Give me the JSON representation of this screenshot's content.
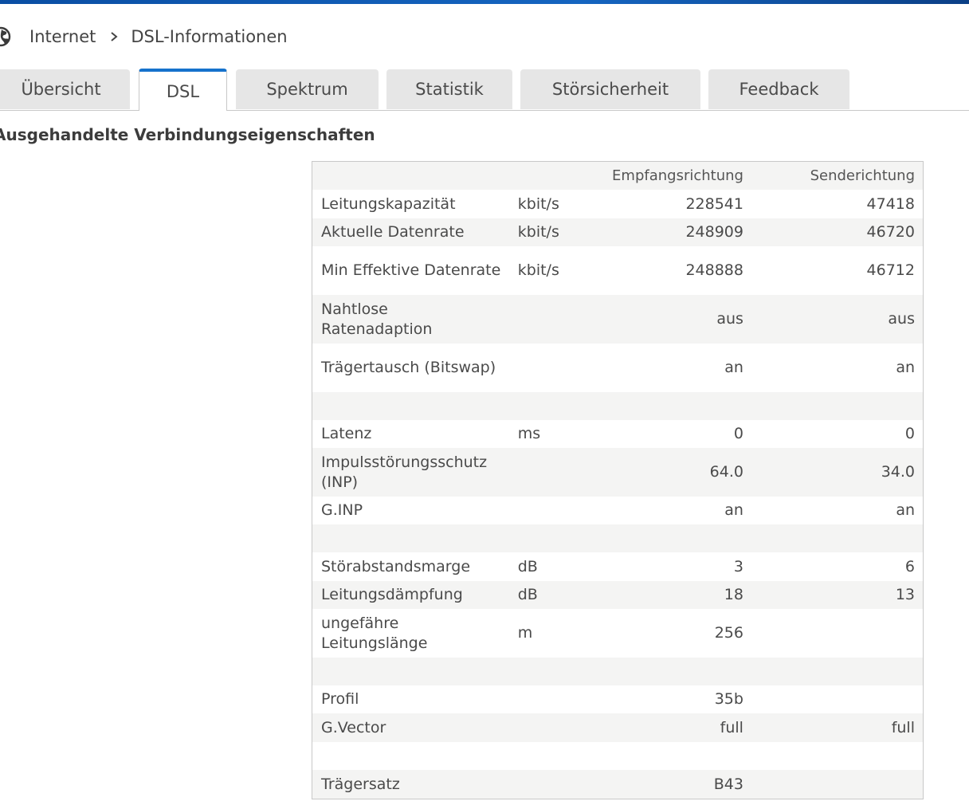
{
  "breadcrumb": {
    "icon": "globe-icon",
    "items": [
      "Internet",
      "DSL-Informationen"
    ]
  },
  "tabs": [
    {
      "label": "Übersicht",
      "active": false
    },
    {
      "label": "DSL",
      "active": true
    },
    {
      "label": "Spektrum",
      "active": false
    },
    {
      "label": "Statistik",
      "active": false
    },
    {
      "label": "Störsicherheit",
      "active": false
    },
    {
      "label": "Feedback",
      "active": false
    }
  ],
  "section": {
    "title": "Ausgehandelte Verbindungseigenschaften"
  },
  "table": {
    "headers": [
      "",
      "",
      "Empfangsrichtung",
      "Senderichtung"
    ],
    "rows": [
      {
        "label": "Leitungskapazität",
        "unit": "kbit/s",
        "rx": "228541",
        "tx": "47418"
      },
      {
        "label": "Aktuelle Datenrate",
        "unit": "kbit/s",
        "rx": "248909",
        "tx": "46720"
      },
      {
        "label": "Min Effektive Datenrate",
        "unit": "kbit/s",
        "rx": "248888",
        "tx": "46712"
      },
      {
        "label": "Nahtlose Ratenadaption",
        "unit": "",
        "rx": "aus",
        "tx": "aus"
      },
      {
        "label": "Trägertausch (Bitswap)",
        "unit": "",
        "rx": "an",
        "tx": "an"
      },
      {
        "label": "",
        "unit": "",
        "rx": "",
        "tx": ""
      },
      {
        "label": "Latenz",
        "unit": "ms",
        "rx": "0",
        "tx": "0"
      },
      {
        "label": "Impulsstörungsschutz (INP)",
        "unit": "",
        "rx": "64.0",
        "tx": "34.0"
      },
      {
        "label": "G.INP",
        "unit": "",
        "rx": "an",
        "tx": "an"
      },
      {
        "label": "",
        "unit": "",
        "rx": "",
        "tx": ""
      },
      {
        "label": "Störabstandsmarge",
        "unit": "dB",
        "rx": "3",
        "tx": "6"
      },
      {
        "label": "Leitungsdämpfung",
        "unit": "dB",
        "rx": "18",
        "tx": "13"
      },
      {
        "label": "ungefähre Leitungslänge",
        "unit": "m",
        "rx": "256",
        "tx": ""
      },
      {
        "label": "",
        "unit": "",
        "rx": "",
        "tx": ""
      },
      {
        "label": "Profil",
        "unit": "",
        "rx": "35b",
        "tx": ""
      },
      {
        "label": "G.Vector",
        "unit": "",
        "rx": "full",
        "tx": "full"
      },
      {
        "label": "",
        "unit": "",
        "rx": "",
        "tx": ""
      },
      {
        "label": "Trägersatz",
        "unit": "",
        "rx": "B43",
        "tx": ""
      }
    ]
  }
}
